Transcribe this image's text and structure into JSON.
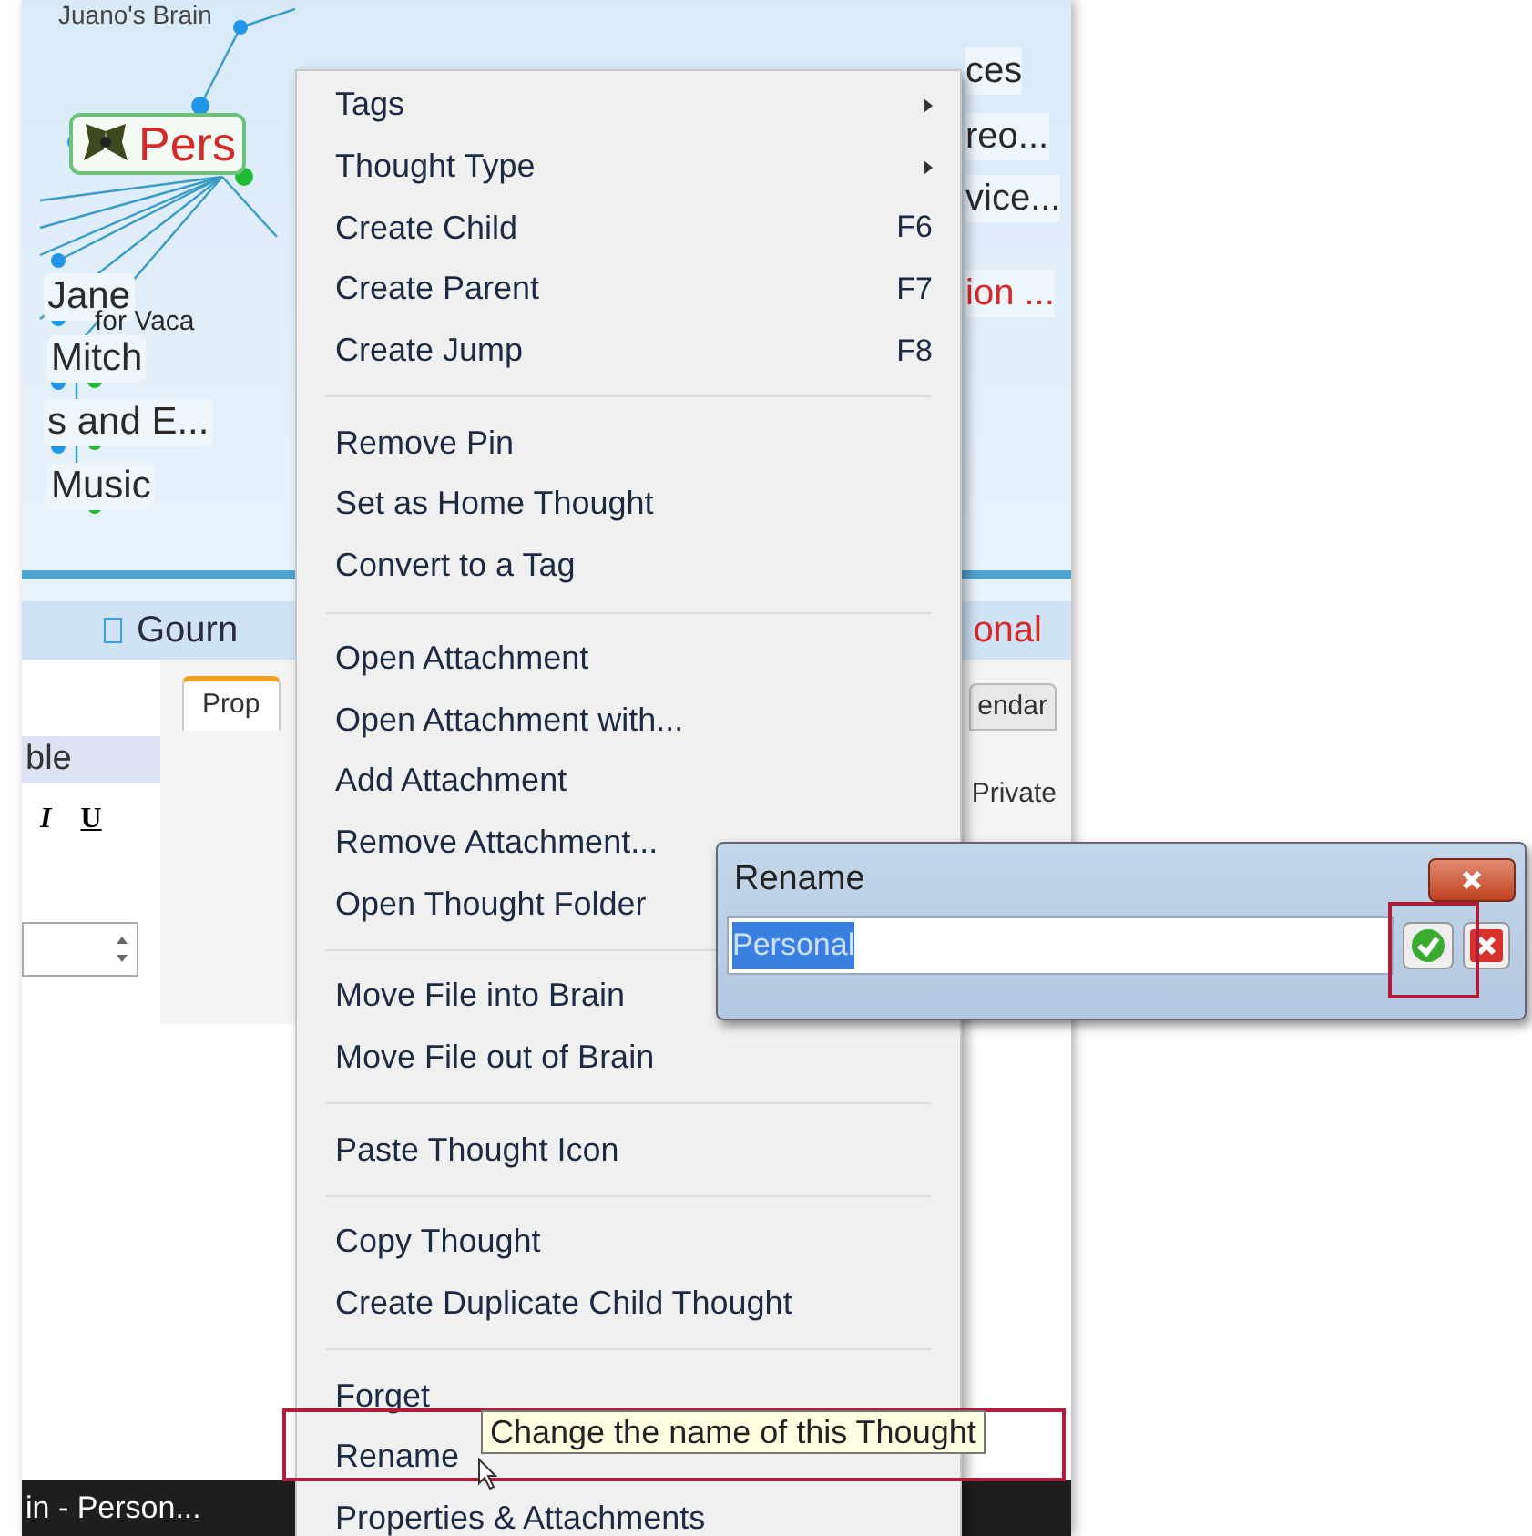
{
  "map": {
    "title": "Juano's Brain",
    "left_nodes": [
      {
        "label": "Pers",
        "color": "#d42a2a",
        "kind": "active"
      },
      {
        "label": "Jane",
        "color": "#2a2a2a",
        "kind": "plain"
      },
      {
        "label": "for Vaca",
        "color": "#2a2a2a",
        "kind": "small"
      },
      {
        "label": "Mitch",
        "color": "#2a2a2a",
        "kind": "plain"
      },
      {
        "label": "s and E...",
        "color": "#2a2a2a",
        "kind": "plain"
      },
      {
        "label": "Music",
        "color": "#2a2a2a",
        "kind": "plain"
      }
    ],
    "right_nodes": [
      {
        "label": "ces",
        "color": "#2a2a2a"
      },
      {
        "label": "reo...",
        "color": "#2a2a2a"
      },
      {
        "label": "vice...",
        "color": "#2a2a2a"
      },
      {
        "label": "ion ...",
        "color": "#d42a2a"
      }
    ]
  },
  "bottom_bar": {
    "left": "Gourn",
    "right": "onal"
  },
  "panel": {
    "left_header": "ble",
    "format_buttons": [
      "I",
      "U"
    ],
    "tabs": [
      {
        "label": "Prop",
        "selected": true
      },
      {
        "label": "endar",
        "selected": false
      }
    ],
    "private_label": "Private"
  },
  "taskbar": {
    "label": "in - Person..."
  },
  "context_menu": {
    "groups": [
      [
        {
          "label": "Tags",
          "submenu": true
        },
        {
          "label": "Thought Type",
          "submenu": true
        },
        {
          "label": "Create Child",
          "shortcut": "F6"
        },
        {
          "label": "Create Parent",
          "shortcut": "F7"
        },
        {
          "label": "Create Jump",
          "shortcut": "F8"
        }
      ],
      [
        {
          "label": "Remove Pin"
        },
        {
          "label": "Set as Home Thought"
        },
        {
          "label": "Convert to a Tag"
        }
      ],
      [
        {
          "label": "Open Attachment"
        },
        {
          "label": "Open Attachment with..."
        },
        {
          "label": "Add Attachment"
        },
        {
          "label": "Remove Attachment..."
        },
        {
          "label": "Open Thought Folder"
        }
      ],
      [
        {
          "label": "Move File into Brain"
        },
        {
          "label": "Move File out of Brain"
        }
      ],
      [
        {
          "label": "Paste Thought Icon"
        }
      ],
      [
        {
          "label": "Copy Thought"
        },
        {
          "label": "Create Duplicate Child Thought"
        }
      ],
      [
        {
          "label": "Forget"
        },
        {
          "label": "Rename"
        },
        {
          "label": "Properties & Attachments"
        }
      ]
    ]
  },
  "tooltip": "Change the name of this Thought",
  "rename_dialog": {
    "title": "Rename",
    "value": "Personal"
  }
}
